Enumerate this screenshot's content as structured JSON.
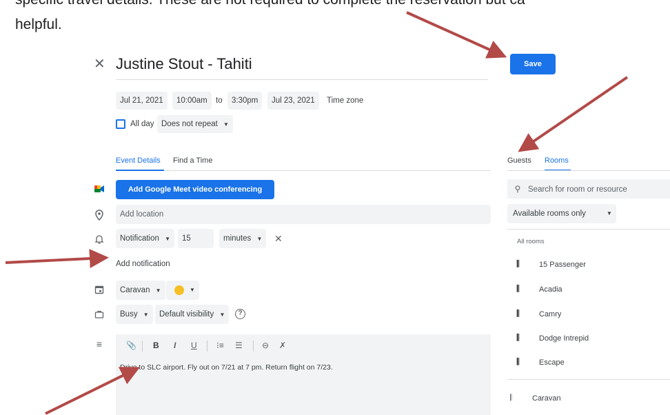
{
  "document": {
    "line1": "specific travel details. These are not required to complete the reservation but ca",
    "line2": "helpful."
  },
  "event": {
    "title": "Justine Stout - Tahiti",
    "save_label": "Save",
    "start_date": "Jul 21, 2021",
    "start_time": "10:00am",
    "to_label": "to",
    "end_time": "3:30pm",
    "end_date": "Jul 23, 2021",
    "time_zone_label": "Time zone",
    "all_day_label": "All day",
    "repeat_value": "Does not repeat"
  },
  "tabs": {
    "event_details": "Event Details",
    "find_time": "Find a Time"
  },
  "details": {
    "meet_label": "Add Google Meet video conferencing",
    "location_placeholder": "Add location",
    "notification_type": "Notification",
    "notification_value": "15",
    "notification_unit": "minutes",
    "add_notification": "Add notification",
    "calendar": "Caravan",
    "busy": "Busy",
    "visibility": "Default visibility",
    "description": "Drive to SLC airport.  Fly out on 7/21 at 7 pm.  Return flight on 7/23."
  },
  "side_tabs": {
    "guests": "Guests",
    "rooms": "Rooms"
  },
  "rooms": {
    "search_placeholder": "Search for room or resource",
    "filter_value": "Available rooms only",
    "all_rooms_label": "All rooms",
    "items": [
      "15 Passenger",
      "Acadia",
      "Camry",
      "Dodge Intrepid",
      "Escape"
    ],
    "selected": "Caravan"
  },
  "colors": {
    "accent": "#1a73e8",
    "calendar_color": "#f6bf26",
    "annotation_arrow": "#b24a48"
  },
  "icons": {
    "close": "close-icon",
    "meet": "google-meet-icon",
    "location": "location-pin-icon",
    "notification": "bell-icon",
    "calendar": "calendar-icon",
    "busy": "briefcase-icon",
    "description": "description-lines-icon",
    "help": "help-icon",
    "room": "room-door-icon"
  }
}
